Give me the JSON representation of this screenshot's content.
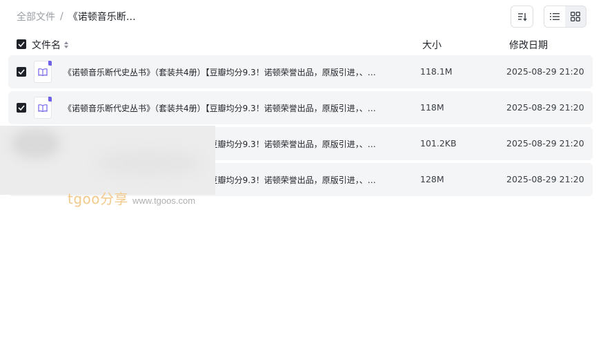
{
  "breadcrumb": {
    "root": "全部文件",
    "separator": "/",
    "current": "《诺顿音乐断…"
  },
  "toolbar": {
    "sort_icon": "sort-icon",
    "list_view_icon": "list-view-icon",
    "grid_view_icon": "grid-view-icon"
  },
  "table": {
    "headers": {
      "name": "文件名",
      "size": "大小",
      "date": "修改日期"
    },
    "rows": [
      {
        "name": "《诺顿音乐断代史丛书》（套装共4册）【豆瓣均分9.3！诺顿荣誉出品，原版引进，、…",
        "size": "118.1M",
        "date": "2025-08-29 21:20"
      },
      {
        "name": "《诺顿音乐断代史丛书》（套装共4册）【豆瓣均分9.3！诺顿荣誉出品，原版引进，、…",
        "size": "118M",
        "date": "2025-08-29 21:20"
      },
      {
        "name": "《诺顿音乐断代史丛书》（套装共4册）【豆瓣均分9.3！诺顿荣誉出品，原版引进，、…",
        "size": "101.2KB",
        "date": "2025-08-29 21:20"
      },
      {
        "name": "《诺顿音乐断代史丛书》（套装共4册）【豆瓣均分9.3！诺顿荣誉出品，原版引进，、…",
        "size": "128M",
        "date": "2025-08-29 21:20"
      }
    ]
  },
  "watermark": {
    "brand": "tgoo分享",
    "url": "www.tgoos.com"
  },
  "colors": {
    "row_bg": "#f4f5f6",
    "file_icon_accent": "#6f62e8",
    "checkbox": "#1f2329"
  }
}
